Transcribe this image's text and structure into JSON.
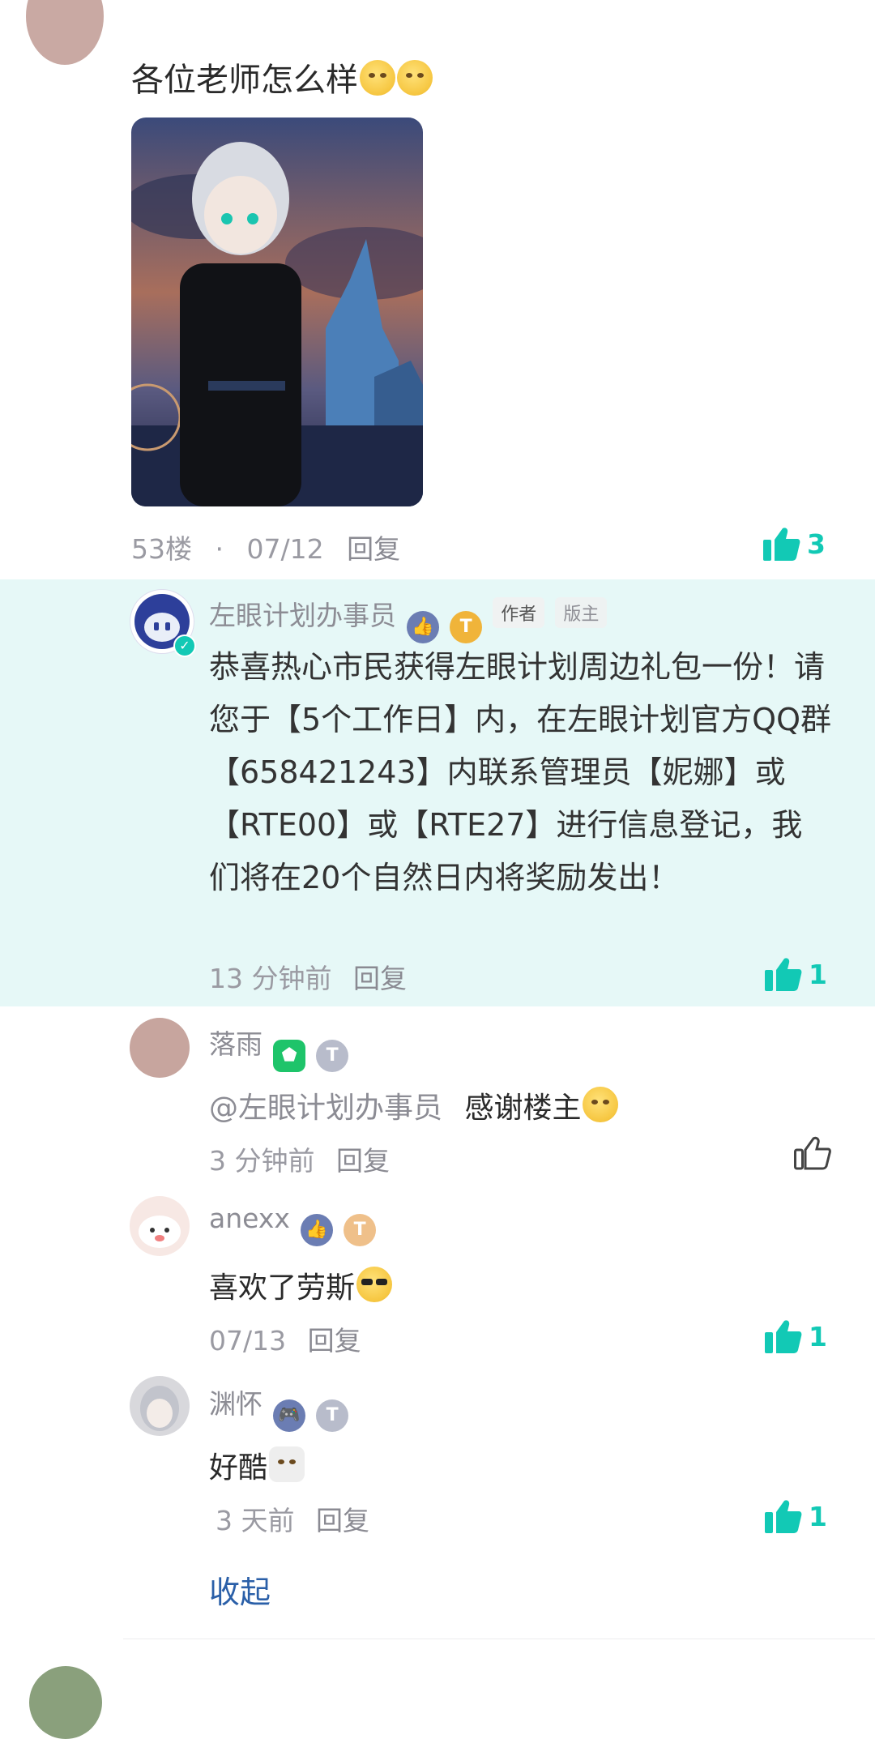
{
  "floor53": {
    "text": "各位老师怎么样",
    "floor": "53楼",
    "dot": "·",
    "date": "07/12",
    "reply": "回复",
    "likes": "3"
  },
  "highlight_reply": {
    "name": "左眼计划办事员",
    "level_badge": "T",
    "tag_author": "作者",
    "tag_admin": "版主",
    "content": "恭喜热心市民获得左眼计划周边礼包一份！请您于【5个工作日】内，在左眼计划官方QQ群【658421243】内联系管理员【妮娜】或【RTE00】或【RTE27】进行信息登记，我们将在20个自然日内将奖励发出！",
    "time": "13 分钟前",
    "reply": "回复",
    "likes": "1"
  },
  "replies": [
    {
      "name": "落雨",
      "level_badge": "T",
      "mention": "@左眼计划办事员",
      "text": "感谢楼主",
      "time": "3 分钟前",
      "reply": "回复",
      "likes": ""
    },
    {
      "name": "anexx",
      "level_badge": "T",
      "text": "喜欢了劳斯",
      "time": "07/13",
      "reply": "回复",
      "likes": "1"
    },
    {
      "name": "渊怀",
      "level_badge": "T",
      "text": "好酷",
      "time": "3 天前",
      "reply": "回复",
      "likes": "1"
    }
  ],
  "collapse": "收起",
  "colors": {
    "accent": "#12c9b5",
    "highlight_bg": "#e6f8f7",
    "link": "#2a5fa8"
  }
}
